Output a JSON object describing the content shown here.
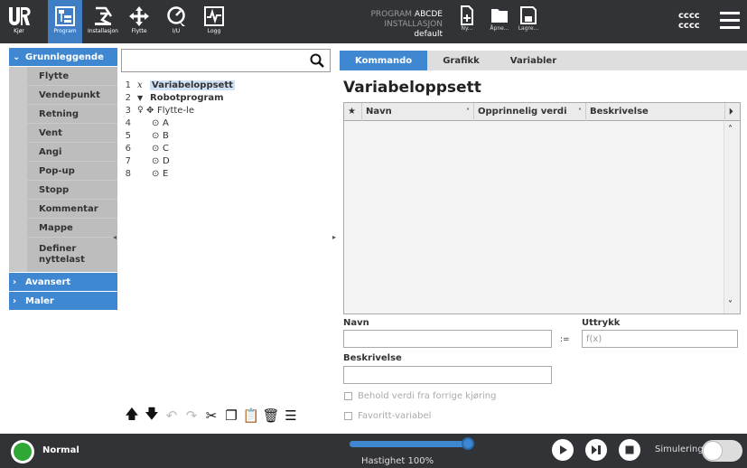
{
  "header": {
    "logo_text": "UR",
    "nav": [
      {
        "label": "Kjør"
      },
      {
        "label": "Program"
      },
      {
        "label": "Installasjon"
      },
      {
        "label": "Flytte"
      },
      {
        "label": "I/U"
      },
      {
        "label": "Logg"
      }
    ],
    "program_key": "PROGRAM",
    "program_value": "ABCDE",
    "installation_key": "INSTALLASJON",
    "installation_value": "default",
    "file_buttons": [
      {
        "label": "Ny..."
      },
      {
        "label": "Åpne..."
      },
      {
        "label": "Lagre..."
      }
    ],
    "user_code_1": "cccc",
    "user_code_2": "cccc"
  },
  "left_panel": {
    "categories": {
      "basic": "Grunnleggende",
      "advanced": "Avansert",
      "templates": "Maler"
    },
    "nodes": [
      "Flytte",
      "Vendepunkt",
      "Retning",
      "Vent",
      "Angi",
      "Pop-up",
      "Stopp",
      "Kommentar",
      "Mappe"
    ],
    "node_payload_line1": "Definer",
    "node_payload_line2": "nyttelast"
  },
  "tree": {
    "search_placeholder": "",
    "rows": [
      {
        "num": "1",
        "text": "Variabeloppsett"
      },
      {
        "num": "2",
        "text": "Robotprogram"
      },
      {
        "num": "3",
        "text": "Flytte-le"
      },
      {
        "num": "4",
        "text": "A"
      },
      {
        "num": "5",
        "text": "B"
      },
      {
        "num": "6",
        "text": "C"
      },
      {
        "num": "7",
        "text": "D"
      },
      {
        "num": "8",
        "text": "E"
      }
    ]
  },
  "right_panel": {
    "tabs": [
      "Kommando",
      "Grafikk",
      "Variabler"
    ],
    "title": "Variabeloppsett",
    "columns": [
      "Navn",
      "Opprinnelig verdi",
      "Beskrivelse"
    ],
    "name_label": "Navn",
    "name_value": "",
    "assign_symbol": ":=",
    "expression_label": "Uttrykk",
    "expression_placeholder": "f(x)",
    "description_label": "Beskrivelse",
    "description_value": "",
    "keep_value_label": "Behold verdi fra forrige kjøring",
    "favorite_label": "Favoritt-variabel"
  },
  "footer": {
    "status": "Normal",
    "speed_label": "Hastighet 100%",
    "speed_fraction": 1.0,
    "simulation_label": "Simulering"
  },
  "colors": {
    "header_bg": "#323337",
    "accent_blue": "#3f88d1",
    "status_green": "#2fa836"
  }
}
